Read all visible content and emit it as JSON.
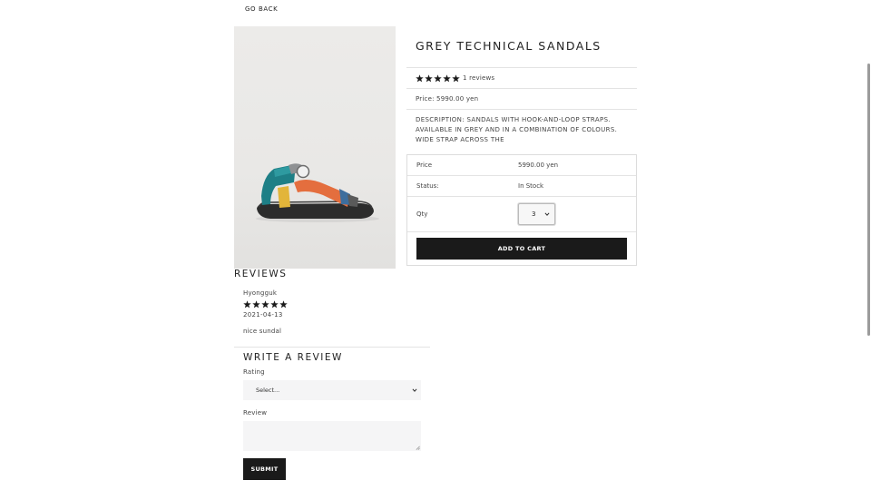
{
  "nav": {
    "go_back": "GO BACK"
  },
  "product": {
    "image_icon": "sandal-product-image",
    "title": "GREY TECHNICAL SANDALS",
    "rating": 5,
    "reviews_count": "1 reviews",
    "price_line": "Price: 5990.00 yen",
    "description": "description: SANDALS WITH HOOK-AND-LOOP STRAPS. AVAILABLE IN GREY AND IN A COMBINATION OF COLOURS. WIDE STRAP ACROSS THE"
  },
  "cart": {
    "price_label": "Price",
    "price_value": "5990.00 yen",
    "status_label": "Status:",
    "status_value": "In Stock",
    "qty_label": "Qty",
    "qty_value": "3",
    "add_to_cart": "ADD TO CART"
  },
  "reviews": {
    "heading": "REVIEWS",
    "items": [
      {
        "name": "Hyongguk",
        "rating": 5,
        "date": "2021-04-13",
        "comment": "nice sundal"
      }
    ]
  },
  "write_review": {
    "heading": "WRITE A REVIEW",
    "rating_label": "Rating",
    "rating_selected": "Select...",
    "review_label": "Review",
    "review_value": "",
    "submit": "SUBMIT"
  },
  "colors": {
    "button_bg": "#1a1a1a",
    "field_bg": "#f5f5f6",
    "border": "#e3e3e3"
  }
}
